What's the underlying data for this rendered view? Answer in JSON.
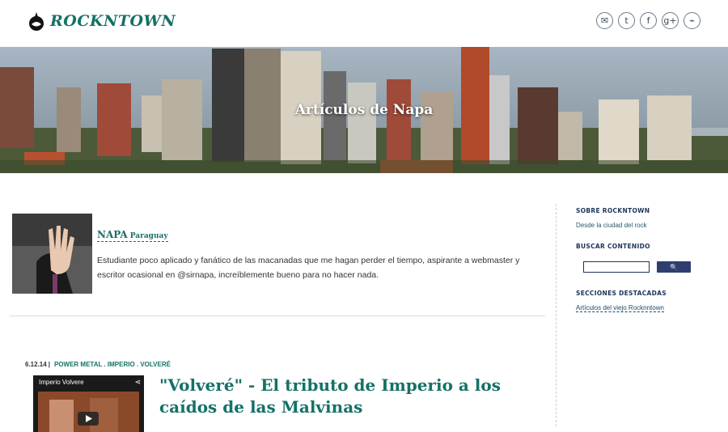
{
  "header": {
    "logo_text": "ROCKNTOWN",
    "social_icons": [
      "mail-icon",
      "twitter-icon",
      "facebook-icon",
      "googleplus-icon",
      "rss-icon"
    ],
    "social_glyphs": [
      "✉",
      "t",
      "f",
      "g+",
      "⌁"
    ]
  },
  "hero": {
    "title": "Artículos de Napa"
  },
  "author": {
    "name": "NAPA",
    "country": "Paraguay",
    "bio": "Estudiante poco aplicado y fanático de las macanadas que me hagan perder el tiempo, aspirante a webmaster y escritor ocasional en @sirnapa, increíblemente bueno para no hacer nada."
  },
  "sidebar": {
    "about_heading": "SOBRE ROCKNTOWN",
    "about_text": "Desde la ciudad del rock",
    "search_heading": "BUSCAR CONTENIDO",
    "search_button": "🔍",
    "featured_heading": "SECCIONES DESTACADAS",
    "featured_link": "Artículos del viejo Rocknntown"
  },
  "post": {
    "date": "6.12.14",
    "tags": "POWER METAL . IMPERIO . VOLVERÉ",
    "thumb_title": "Imperio Volvere",
    "title": "\"Volveré\" - El tributo de Imperio a los caídos de las Malvinas"
  },
  "colors": {
    "accent": "#157166",
    "navy": "#1d3557"
  }
}
